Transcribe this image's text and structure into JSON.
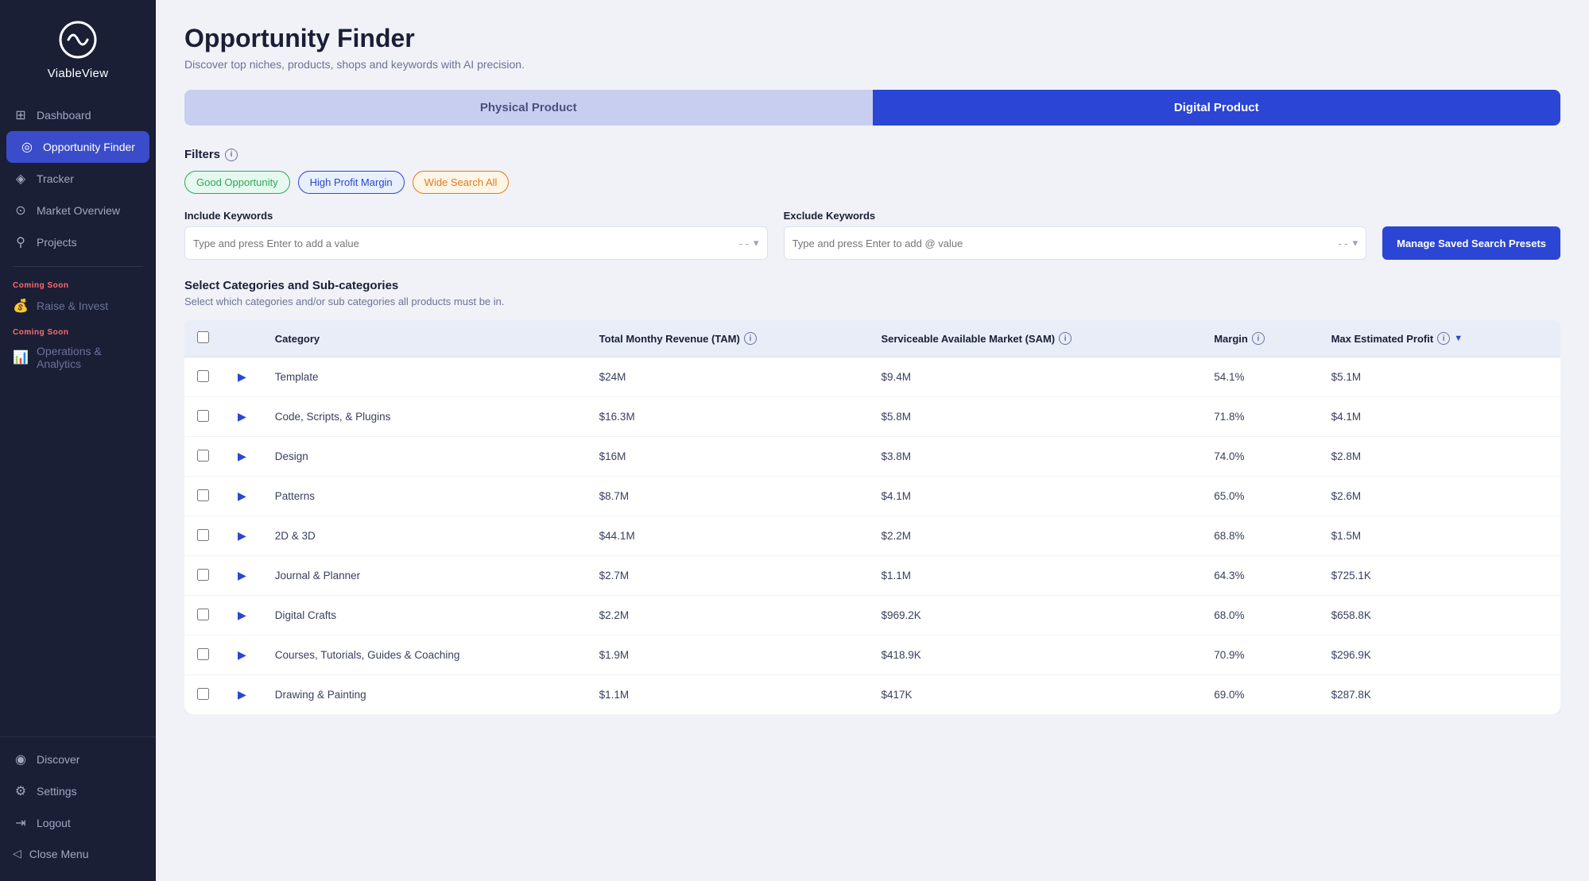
{
  "sidebar": {
    "logo_text_bold": "Viable",
    "logo_text_light": "View",
    "nav_items": [
      {
        "id": "dashboard",
        "label": "Dashboard",
        "icon": "⊞",
        "active": false
      },
      {
        "id": "opportunity-finder",
        "label": "Opportunity Finder",
        "icon": "◎",
        "active": true
      },
      {
        "id": "tracker",
        "label": "Tracker",
        "icon": "◈",
        "active": false
      },
      {
        "id": "market-overview",
        "label": "Market Overview",
        "icon": "⊙",
        "active": false
      },
      {
        "id": "projects",
        "label": "Projects",
        "icon": "⚲",
        "active": false
      }
    ],
    "coming_soon_items": [
      {
        "id": "raise-invest",
        "label": "Raise & Invest",
        "coming_soon_label": "Coming Soon"
      },
      {
        "id": "operations-analytics",
        "label": "Operations & Analytics",
        "coming_soon_label": "Coming Soon"
      }
    ],
    "bottom_items": [
      {
        "id": "discover",
        "label": "Discover",
        "icon": "◉"
      },
      {
        "id": "settings",
        "label": "Settings",
        "icon": "⚙"
      },
      {
        "id": "logout",
        "label": "Logout",
        "icon": "⇥"
      }
    ],
    "close_menu_label": "Close Menu",
    "close_menu_icon": "◁"
  },
  "page": {
    "title": "Opportunity Finder",
    "subtitle": "Discover top niches, products, shops and keywords with AI precision."
  },
  "tabs": [
    {
      "id": "physical",
      "label": "Physical Product",
      "active": false
    },
    {
      "id": "digital",
      "label": "Digital Product",
      "active": true
    }
  ],
  "filters": {
    "section_label": "Filters",
    "chips": [
      {
        "id": "good-opportunity",
        "label": "Good Opportunity",
        "style": "green"
      },
      {
        "id": "high-profit",
        "label": "High Profit Margin",
        "style": "blue"
      },
      {
        "id": "wide-search",
        "label": "Wide Search All",
        "style": "orange"
      }
    ]
  },
  "keywords": {
    "include_label": "Include Keywords",
    "include_placeholder": "Type and press Enter to add a value",
    "exclude_label": "Exclude Keywords",
    "exclude_placeholder": "Type and press Enter to add @ value",
    "manage_btn_label": "Manage Saved Search Presets"
  },
  "categories_section": {
    "title": "Select Categories and Sub-categories",
    "subtitle": "Select which categories and/or sub categories all products must be in."
  },
  "table": {
    "columns": [
      {
        "id": "checkbox",
        "label": ""
      },
      {
        "id": "expand",
        "label": ""
      },
      {
        "id": "category",
        "label": "Category"
      },
      {
        "id": "tam",
        "label": "Total Monthy Revenue (TAM)",
        "info": true
      },
      {
        "id": "sam",
        "label": "Serviceable Available Market (SAM)",
        "info": true
      },
      {
        "id": "margin",
        "label": "Margin",
        "info": true
      },
      {
        "id": "max-profit",
        "label": "Max Estimated Profit",
        "info": true,
        "sortable": true,
        "sort_dir": "desc"
      }
    ],
    "rows": [
      {
        "category": "Template",
        "tam": "$24M",
        "sam": "$9.4M",
        "margin": "54.1%",
        "max_profit": "$5.1M"
      },
      {
        "category": "Code, Scripts, & Plugins",
        "tam": "$16.3M",
        "sam": "$5.8M",
        "margin": "71.8%",
        "max_profit": "$4.1M"
      },
      {
        "category": "Design",
        "tam": "$16M",
        "sam": "$3.8M",
        "margin": "74.0%",
        "max_profit": "$2.8M"
      },
      {
        "category": "Patterns",
        "tam": "$8.7M",
        "sam": "$4.1M",
        "margin": "65.0%",
        "max_profit": "$2.6M"
      },
      {
        "category": "2D & 3D",
        "tam": "$44.1M",
        "sam": "$2.2M",
        "margin": "68.8%",
        "max_profit": "$1.5M"
      },
      {
        "category": "Journal & Planner",
        "tam": "$2.7M",
        "sam": "$1.1M",
        "margin": "64.3%",
        "max_profit": "$725.1K"
      },
      {
        "category": "Digital Crafts",
        "tam": "$2.2M",
        "sam": "$969.2K",
        "margin": "68.0%",
        "max_profit": "$658.8K"
      },
      {
        "category": "Courses, Tutorials, Guides & Coaching",
        "tam": "$1.9M",
        "sam": "$418.9K",
        "margin": "70.9%",
        "max_profit": "$296.9K"
      },
      {
        "category": "Drawing & Painting",
        "tam": "$1.1M",
        "sam": "$417K",
        "margin": "69.0%",
        "max_profit": "$287.8K"
      }
    ]
  },
  "colors": {
    "sidebar_bg": "#1a1f36",
    "active_nav": "#3b4cca",
    "primary_btn": "#2b45d4",
    "tab_active": "#2b45d4",
    "tab_inactive": "#c8cef0"
  }
}
